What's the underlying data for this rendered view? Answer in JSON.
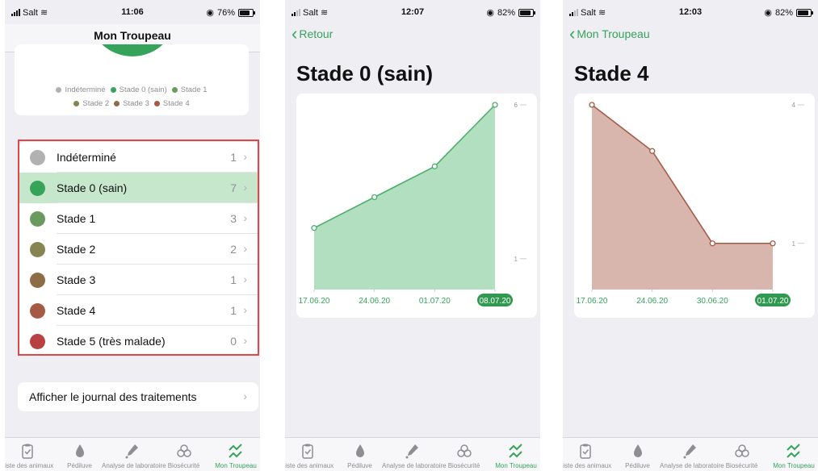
{
  "screen1": {
    "status": {
      "carrier": "Salt",
      "time": "11:06",
      "battery": "76%",
      "battery_level": 0.76
    },
    "nav_title": "Mon Troupeau",
    "legend": [
      {
        "label": "Indéterminé",
        "color": "#b1b1b1"
      },
      {
        "label": "Stade 0 (sain)",
        "color": "#35a35a"
      },
      {
        "label": "Stade 1",
        "color": "#6a9b5e"
      },
      {
        "label": "Stade 2",
        "color": "#868551"
      },
      {
        "label": "Stade 3",
        "color": "#8e6c48"
      },
      {
        "label": "Stade 4",
        "color": "#a55a43"
      },
      {
        "label": "Stade 5 (très malade)",
        "color": "#b84142"
      }
    ],
    "rows": [
      {
        "label": "Indéterminé",
        "count": "1",
        "color": "#b1b1b1",
        "selected": false
      },
      {
        "label": "Stade 0 (sain)",
        "count": "7",
        "color": "#35a35a",
        "selected": true
      },
      {
        "label": "Stade 1",
        "count": "3",
        "color": "#6a9b5e",
        "selected": false
      },
      {
        "label": "Stade 2",
        "count": "2",
        "color": "#868551",
        "selected": false
      },
      {
        "label": "Stade 3",
        "count": "1",
        "color": "#8e6c48",
        "selected": false
      },
      {
        "label": "Stade 4",
        "count": "1",
        "color": "#a55a43",
        "selected": false
      },
      {
        "label": "Stade 5 (très malade)",
        "count": "0",
        "color": "#b84142",
        "selected": false
      }
    ],
    "journal_label": "Afficher le journal des traitements"
  },
  "screen2": {
    "status": {
      "carrier": "Salt",
      "time": "12:07",
      "battery": "82%",
      "battery_level": 0.82
    },
    "back_label": "Retour",
    "title": "Stade 0 (sain)"
  },
  "screen3": {
    "status": {
      "carrier": "Salt",
      "time": "12:03",
      "battery": "82%",
      "battery_level": 0.82
    },
    "back_label": "Mon Troupeau",
    "title": "Stade 4"
  },
  "tabs": [
    {
      "label": "Liste des animaux",
      "icon": "clipboard-check-icon"
    },
    {
      "label": "Pédiluve",
      "icon": "drop-icon"
    },
    {
      "label": "Analyse de laboratoire",
      "icon": "pipette-icon"
    },
    {
      "label": "Biosécurité",
      "icon": "biohazard-icon"
    },
    {
      "label": "Mon Troupeau",
      "icon": "trend-chart-icon",
      "active": true
    }
  ],
  "colors": {
    "accent": "#35a35a",
    "selection": "#c7e7cd",
    "highlight_box": "#e2464b"
  },
  "chart_data": [
    {
      "type": "area",
      "x": [
        "17.06.20",
        "24.06.20",
        "01.07.20",
        "08.07.20"
      ],
      "y": [
        2,
        3,
        4,
        6
      ],
      "ytick_labels": [
        "1",
        "6"
      ],
      "ylim": [
        0,
        6
      ],
      "highlighted_x": "08.07.20",
      "color": "#4caf69",
      "fill": "#b2dfc0"
    },
    {
      "type": "area",
      "x": [
        "17.06.20",
        "24.06.20",
        "30.06.20",
        "01.07.20"
      ],
      "y": [
        4,
        3,
        1,
        1
      ],
      "ytick_labels": [
        "1",
        "4"
      ],
      "ylim": [
        0,
        4
      ],
      "highlighted_x": "01.07.20",
      "color": "#a55a43",
      "fill": "#d8b6ae"
    }
  ]
}
